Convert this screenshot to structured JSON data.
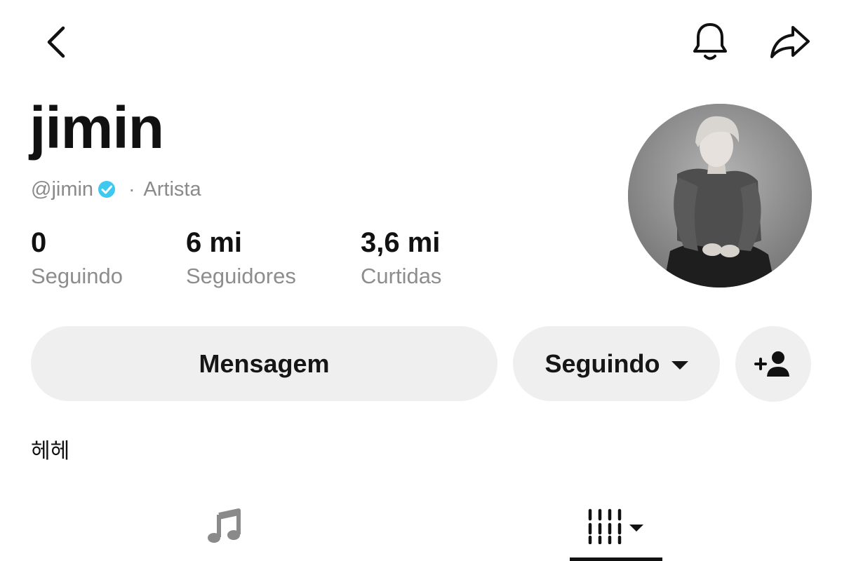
{
  "header": {
    "back_icon": "chevron-left-icon",
    "bell_icon": "bell-icon",
    "share_icon": "share-arrow-icon"
  },
  "profile": {
    "display_name": "jimin",
    "handle": "@jimin",
    "verified": true,
    "category": "Artista",
    "verified_color": "#3ec9f0"
  },
  "stats": [
    {
      "value": "0",
      "label": "Seguindo"
    },
    {
      "value": "6 mi",
      "label": "Seguidores"
    },
    {
      "value": "3,6 mi",
      "label": "Curtidas"
    }
  ],
  "actions": {
    "message_label": "Mensagem",
    "following_label": "Seguindo",
    "add_friend_icon": "add-person-icon"
  },
  "bio": {
    "text": "헤헤"
  },
  "tabs": [
    {
      "icon": "music-note-icon",
      "active": false
    },
    {
      "icon": "playlist-bars-icon",
      "active": true
    }
  ]
}
